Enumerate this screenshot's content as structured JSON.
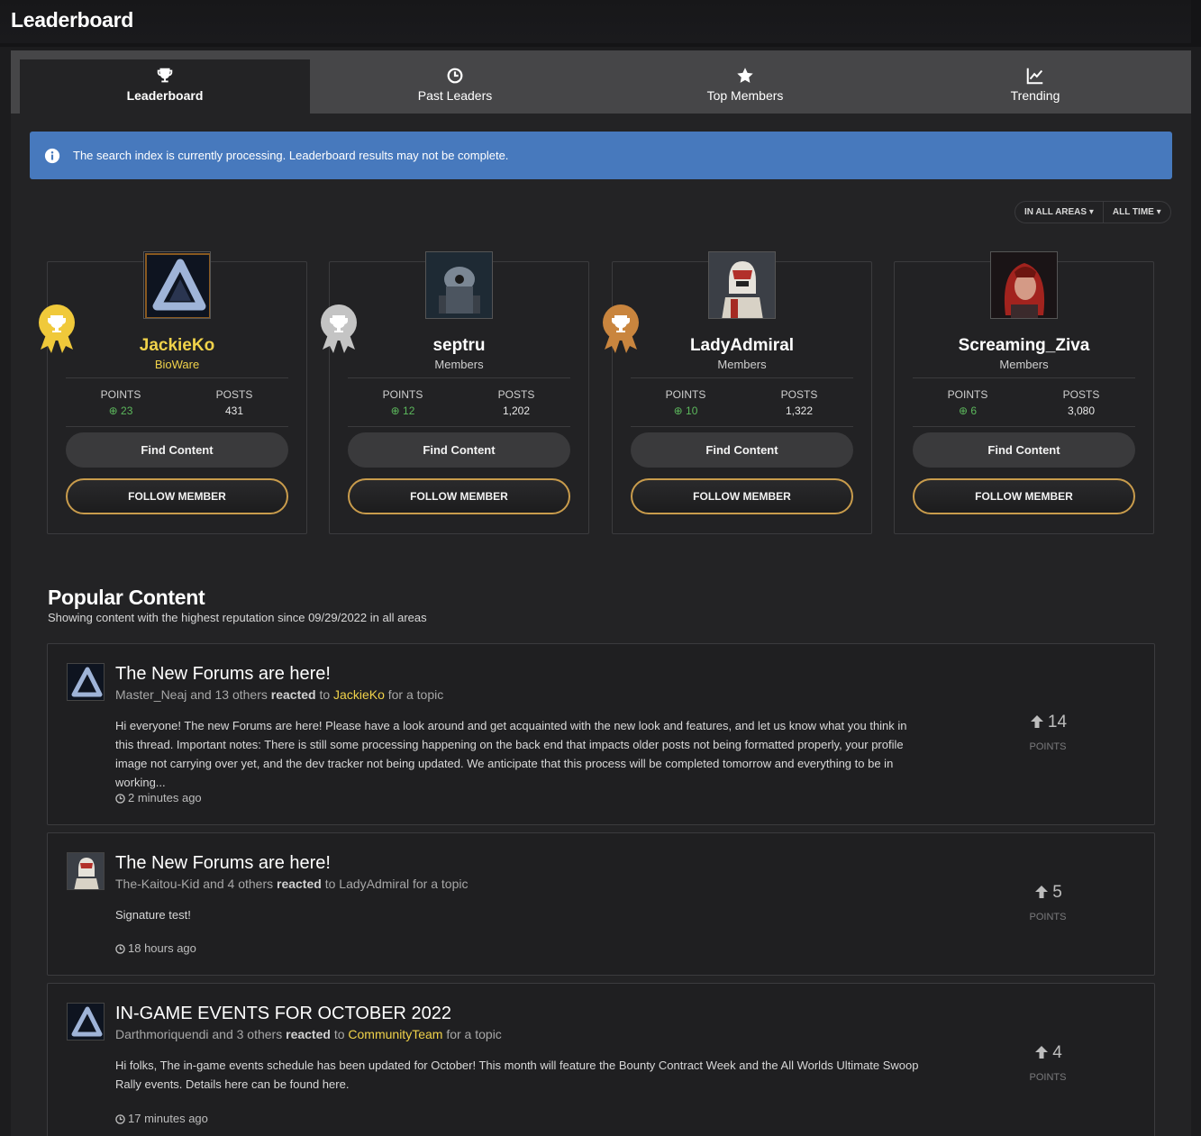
{
  "page": {
    "title": "Leaderboard"
  },
  "tabs": [
    {
      "label": "Leaderboard",
      "icon": "trophy-icon",
      "active": true
    },
    {
      "label": "Past Leaders",
      "icon": "clock-icon",
      "active": false
    },
    {
      "label": "Top Members",
      "icon": "star-icon",
      "active": false
    },
    {
      "label": "Trending",
      "icon": "line-chart-icon",
      "active": false
    }
  ],
  "alert": {
    "icon": "info-icon",
    "text": "The search index is currently processing. Leaderboard results may not be complete."
  },
  "filters": {
    "area": "IN ALL AREAS",
    "time": "ALL TIME"
  },
  "leaders": [
    {
      "rank": 1,
      "badge": "gold-trophy-badge",
      "badge_color": "#f0c93a",
      "name": "JackieKo",
      "name_color": "#f0d24a",
      "group": "BioWare",
      "group_color": "#f0d24a",
      "points_label": "POINTS",
      "points": "23",
      "posts_label": "POSTS",
      "posts": "431",
      "find_label": "Find Content",
      "follow_label": "FOLLOW MEMBER"
    },
    {
      "rank": 2,
      "badge": "silver-trophy-badge",
      "badge_color": "#c4c4c4",
      "name": "septru",
      "name_color": "#ffffff",
      "group": "Members",
      "group_color": "#cfcfcf",
      "points_label": "POINTS",
      "points": "12",
      "posts_label": "POSTS",
      "posts": "1,202",
      "find_label": "Find Content",
      "follow_label": "FOLLOW MEMBER"
    },
    {
      "rank": 3,
      "badge": "bronze-trophy-badge",
      "badge_color": "#c9853e",
      "name": "LadyAdmiral",
      "name_color": "#ffffff",
      "group": "Members",
      "group_color": "#cfcfcf",
      "points_label": "POINTS",
      "points": "10",
      "posts_label": "POSTS",
      "posts": "1,322",
      "find_label": "Find Content",
      "follow_label": "FOLLOW MEMBER"
    },
    {
      "rank": 4,
      "badge": "",
      "badge_color": "",
      "name": "Screaming_Ziva",
      "name_color": "#ffffff",
      "group": "Members",
      "group_color": "#cfcfcf",
      "points_label": "POINTS",
      "points": "6",
      "posts_label": "POSTS",
      "posts": "3,080",
      "find_label": "Find Content",
      "follow_label": "FOLLOW MEMBER"
    }
  ],
  "popular": {
    "title": "Popular Content",
    "subtitle": "Showing content with the highest reputation since 09/29/2022 in all areas",
    "posts": [
      {
        "title": "The New Forums are here!",
        "meta_user": "Master_Neaj and 13 others",
        "meta_reacted": "reacted",
        "meta_to": "to",
        "meta_target": "JackieKo",
        "meta_target_highlight": true,
        "meta_suffix": "for a topic",
        "body": "Hi everyone! The new Forums are here! Please have a look around and get acquainted with the new look and features, and let us know what you think in this thread. Important notes: There is still some processing happening on the back end that impacts older posts not being formatted properly, your profile image not carrying over yet, and the dev tracker not being updated. We anticipate that this process will be completed tomorrow and everything to be in working...",
        "time": "2 minutes ago",
        "score": "14",
        "score_label": "POINTS"
      },
      {
        "title": "The New Forums are here!",
        "meta_user": "The-Kaitou-Kid and 4 others",
        "meta_reacted": "reacted",
        "meta_to": "to",
        "meta_target": "LadyAdmiral",
        "meta_target_highlight": false,
        "meta_suffix": "for a topic",
        "body": "Signature test!",
        "time": "18 hours ago",
        "score": "5",
        "score_label": "POINTS"
      },
      {
        "title": "IN-GAME EVENTS FOR OCTOBER 2022",
        "meta_user": "Darthmoriquendi and 3 others",
        "meta_reacted": "reacted",
        "meta_to": "to",
        "meta_target": "CommunityTeam",
        "meta_target_highlight": true,
        "meta_suffix": "for a topic",
        "body": "Hi folks, The in-game events schedule has been updated for October! This month will feature the Bounty Contract Week and the All Worlds Ultimate Swoop Rally events. Details here can be found here.",
        "time": "17 minutes ago",
        "score": "4",
        "score_label": "POINTS"
      }
    ]
  }
}
